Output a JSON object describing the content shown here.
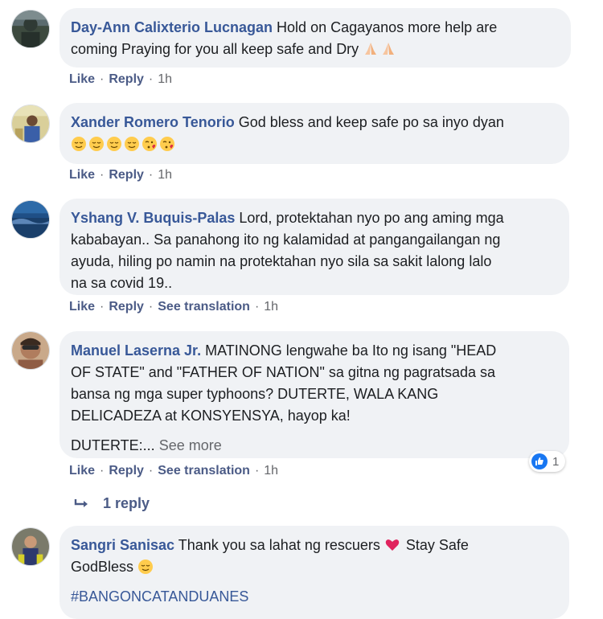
{
  "comments": [
    {
      "name": "Day-Ann Calixterio Lucnagan",
      "text_line1": " Hold on Cagayanos more help are",
      "text_line2": "coming Praying for you all keep safe and Dry",
      "actions": {
        "like": "Like",
        "reply": "Reply",
        "time": "1h"
      },
      "emojis": [
        "folded-hands",
        "folded-hands"
      ]
    },
    {
      "name": "Xander Romero Tenorio",
      "text_line1": " God bless and keep safe po sa inyo dyan",
      "actions": {
        "like": "Like",
        "reply": "Reply",
        "time": "1h"
      },
      "emojis": [
        "relieved-face",
        "relieved-face",
        "relieved-face",
        "relieved-face",
        "kissing-heart-face",
        "kissing-heart-face"
      ]
    },
    {
      "name": "Yshang V. Buquis-Palas",
      "text_line1": " Lord, protektahan nyo po ang aming mga",
      "text_line2": "kababayan.. Sa panahong ito ng kalamidad at pangangailangan ng",
      "text_line3": "ayuda, hiling po namin na protektahan nyo sila sa sakit lalong lalo",
      "text_line4": "na sa covid 19..",
      "actions": {
        "like": "Like",
        "reply": "Reply",
        "translate": "See translation",
        "time": "1h"
      }
    },
    {
      "name": "Manuel Laserna Jr.",
      "text_line1": " MATINONG lengwahe ba Ito ng isang \"HEAD",
      "text_line2": "OF STATE\" and \"FATHER OF NATION\" sa gitna ng pagratsada sa",
      "text_line3": "bansa ng mga super typhoons? DUTERTE, WALA KANG",
      "text_line4": "DELICADEZA at KONSYENSYA, hayop ka!",
      "text_line5": "DUTERTE:...",
      "see_more": "See more",
      "actions": {
        "like": "Like",
        "reply": "Reply",
        "translate": "See translation",
        "time": "1h"
      },
      "reaction_count": "1",
      "replies": "1 reply"
    },
    {
      "name": "Sangri Sanisac",
      "text_line1": " Thank you sa lahat ng rescuers ",
      "text_line1b": " Stay Safe",
      "text_line2": "GodBless ",
      "hashtag": "#BANGONCATANDUANES",
      "emojis": [
        "red-heart",
        "relieved-face"
      ]
    }
  ],
  "separator": "·"
}
